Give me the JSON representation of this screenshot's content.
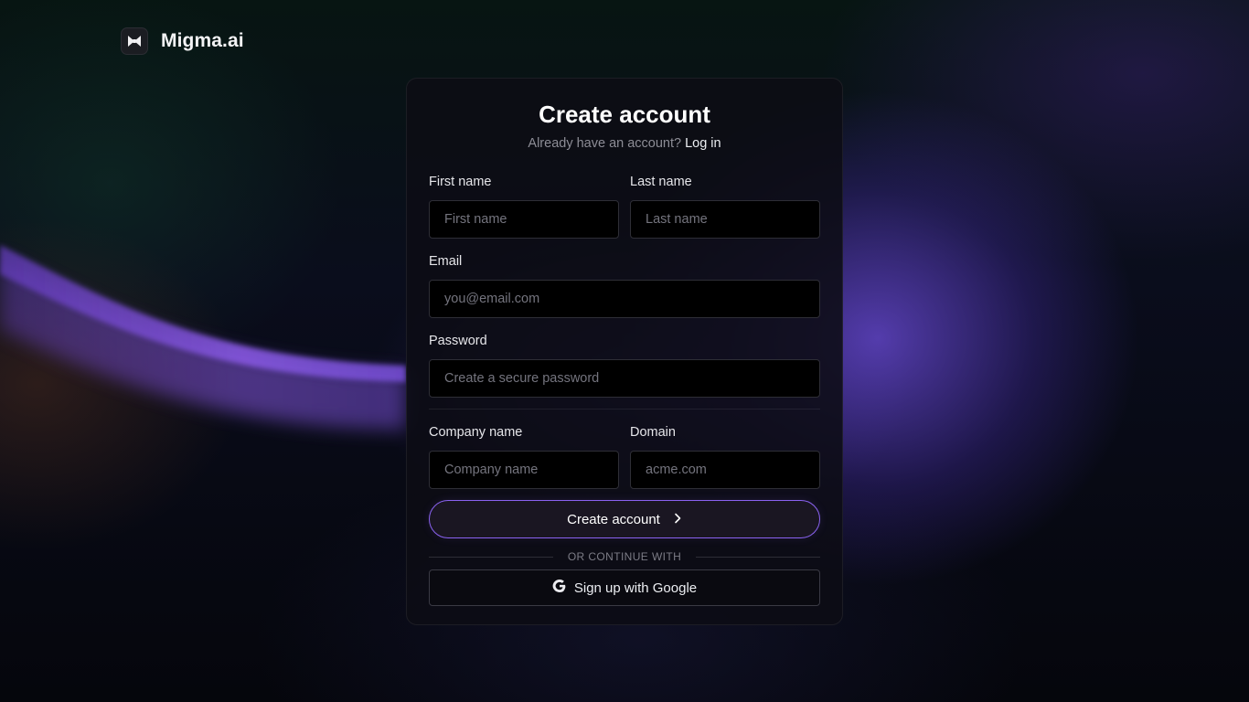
{
  "brand": {
    "name": "Migma.ai",
    "logo_icon": "bowtie-icon"
  },
  "form": {
    "title": "Create account",
    "have_account_text": "Already have an account?",
    "login_link": "Log in",
    "first_name": {
      "label": "First name",
      "placeholder": "First name"
    },
    "last_name": {
      "label": "Last name",
      "placeholder": "Last name"
    },
    "email": {
      "label": "Email",
      "placeholder": "you@email.com"
    },
    "password": {
      "label": "Password",
      "placeholder": "Create a secure password"
    },
    "company": {
      "label": "Company name",
      "placeholder": "Company name"
    },
    "domain": {
      "label": "Domain",
      "placeholder": "acme.com"
    },
    "submit_label": "Create account",
    "submit_icon": "chevron-right-icon",
    "or_text": "OR CONTINUE WITH",
    "google_label": "Sign up with Google",
    "google_icon": "google-icon"
  },
  "colors": {
    "accent": "#8a62f0",
    "card_bg": "#0d0c14",
    "input_bg": "#000000"
  }
}
